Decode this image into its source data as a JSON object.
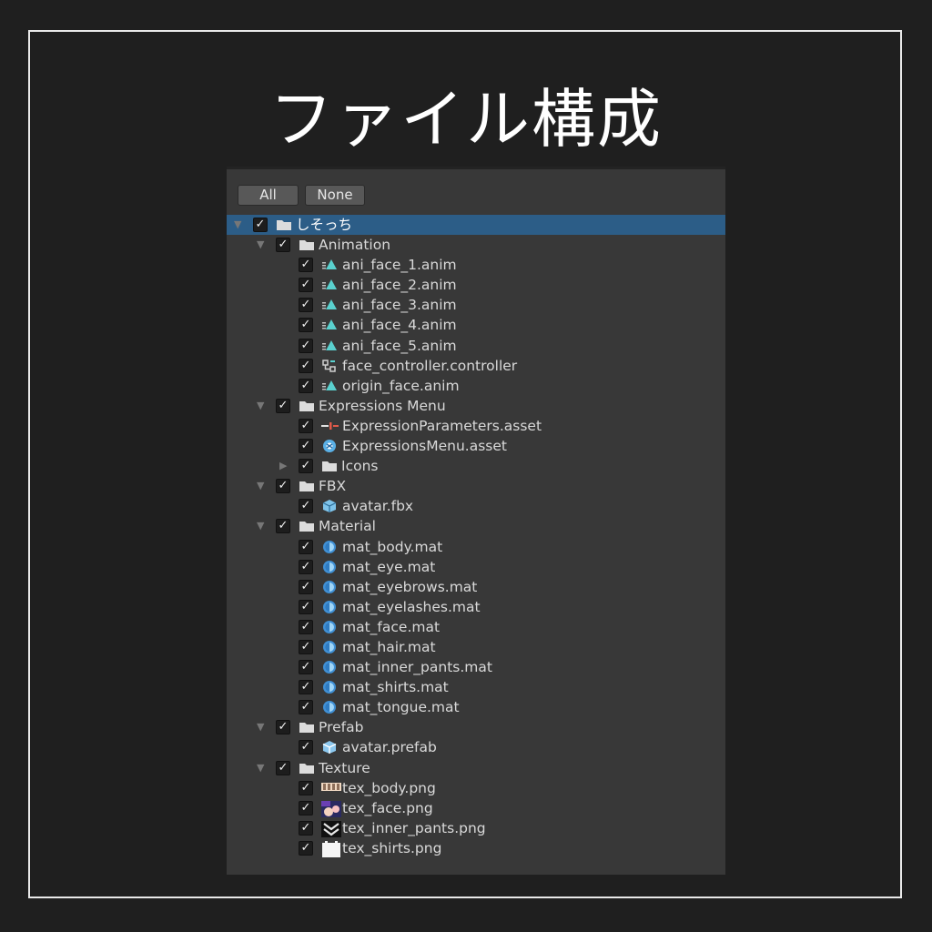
{
  "page_title": "ファイル構成",
  "toolbar": {
    "all_label": "All",
    "none_label": "None"
  },
  "tree": [
    {
      "depth": 0,
      "expanded": true,
      "type": "folder",
      "label": "しそっち",
      "selected": true
    },
    {
      "depth": 1,
      "expanded": true,
      "type": "folder",
      "label": "Animation"
    },
    {
      "depth": 2,
      "type": "anim",
      "label": "ani_face_1.anim"
    },
    {
      "depth": 2,
      "type": "anim",
      "label": "ani_face_2.anim"
    },
    {
      "depth": 2,
      "type": "anim",
      "label": "ani_face_3.anim"
    },
    {
      "depth": 2,
      "type": "anim",
      "label": "ani_face_4.anim"
    },
    {
      "depth": 2,
      "type": "anim",
      "label": "ani_face_5.anim"
    },
    {
      "depth": 2,
      "type": "controller",
      "label": "face_controller.controller"
    },
    {
      "depth": 2,
      "type": "anim",
      "label": "origin_face.anim"
    },
    {
      "depth": 1,
      "expanded": true,
      "type": "folder",
      "label": "Expressions Menu"
    },
    {
      "depth": 2,
      "type": "params",
      "label": "ExpressionParameters.asset"
    },
    {
      "depth": 2,
      "type": "menu",
      "label": "ExpressionsMenu.asset"
    },
    {
      "depth": 2,
      "expanded": false,
      "type": "folder",
      "label": "Icons"
    },
    {
      "depth": 1,
      "expanded": true,
      "type": "folder",
      "label": "FBX"
    },
    {
      "depth": 2,
      "type": "model",
      "label": "avatar.fbx"
    },
    {
      "depth": 1,
      "expanded": true,
      "type": "folder",
      "label": "Material"
    },
    {
      "depth": 2,
      "type": "material",
      "label": "mat_body.mat"
    },
    {
      "depth": 2,
      "type": "material",
      "label": "mat_eye.mat"
    },
    {
      "depth": 2,
      "type": "material",
      "label": "mat_eyebrows.mat"
    },
    {
      "depth": 2,
      "type": "material",
      "label": "mat_eyelashes.mat"
    },
    {
      "depth": 2,
      "type": "material",
      "label": "mat_face.mat"
    },
    {
      "depth": 2,
      "type": "material",
      "label": "mat_hair.mat"
    },
    {
      "depth": 2,
      "type": "material",
      "label": "mat_inner_pants.mat"
    },
    {
      "depth": 2,
      "type": "material",
      "label": "mat_shirts.mat"
    },
    {
      "depth": 2,
      "type": "material",
      "label": "mat_tongue.mat"
    },
    {
      "depth": 1,
      "expanded": true,
      "type": "folder",
      "label": "Prefab"
    },
    {
      "depth": 2,
      "type": "prefab",
      "label": "avatar.prefab"
    },
    {
      "depth": 1,
      "expanded": true,
      "type": "folder",
      "label": "Texture"
    },
    {
      "depth": 2,
      "type": "tex_body",
      "label": "tex_body.png"
    },
    {
      "depth": 2,
      "type": "tex_face",
      "label": "tex_face.png"
    },
    {
      "depth": 2,
      "type": "tex_pants",
      "label": "tex_inner_pants.png"
    },
    {
      "depth": 2,
      "type": "tex_shirts",
      "label": "tex_shirts.png"
    }
  ],
  "icon_names": {
    "folder": "folder-icon",
    "anim": "animation-clip-icon",
    "controller": "animator-controller-icon",
    "params": "expression-parameters-icon",
    "menu": "expressions-menu-icon",
    "model": "model-icon",
    "material": "material-icon",
    "prefab": "prefab-icon",
    "tex_body": "texture-thumbnail-icon",
    "tex_face": "texture-thumbnail-icon",
    "tex_pants": "texture-thumbnail-icon",
    "tex_shirts": "texture-thumbnail-icon"
  },
  "colors": {
    "selection": "#2c5d87",
    "panel": "#383838",
    "background": "#1f1f1f",
    "accent": "#5ad1cf"
  }
}
